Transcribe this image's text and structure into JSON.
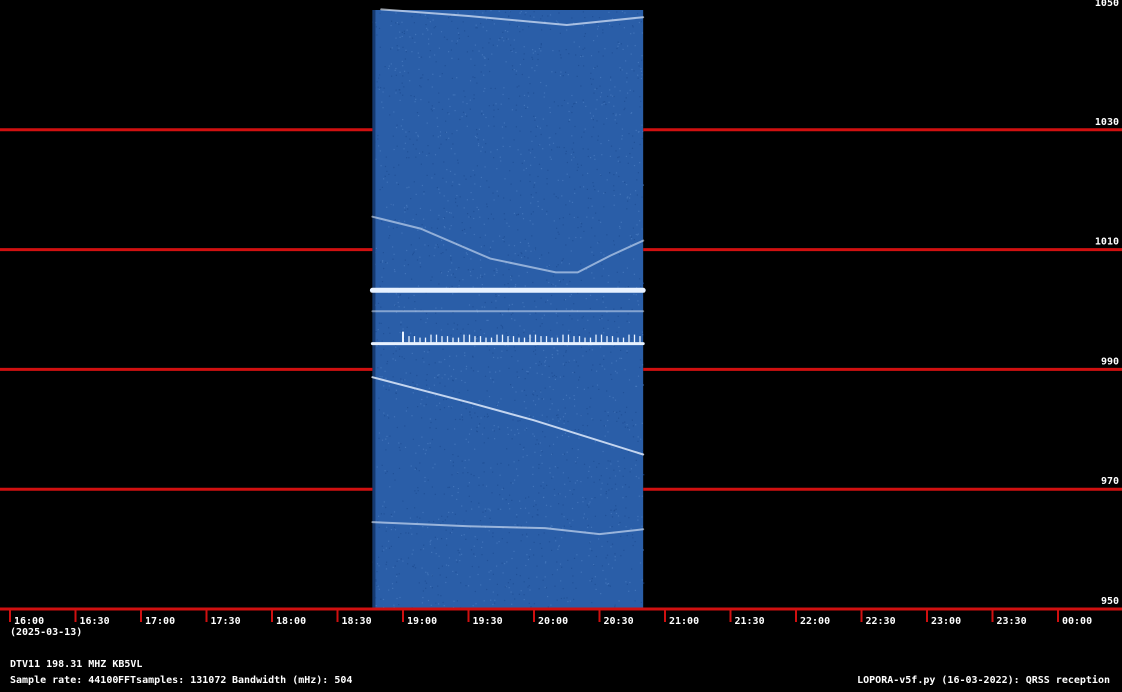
{
  "chart_data": {
    "type": "spectrogram",
    "yaxis": {
      "min": 950,
      "max": 1050,
      "ticks": [
        950,
        970,
        990,
        1010,
        1030,
        1050
      ]
    },
    "xaxis": {
      "ticks": [
        "16:00",
        "16:30",
        "17:00",
        "17:30",
        "18:00",
        "18:30",
        "19:00",
        "19:30",
        "20:00",
        "20:30",
        "21:00",
        "21:30",
        "22:00",
        "22:30",
        "23:00",
        "23:30",
        "00:00"
      ],
      "date_label": "(2025-03-13)"
    },
    "grid": true,
    "data_window": {
      "start": "18:46",
      "end": "20:50"
    },
    "traces": [
      {
        "name": "",
        "points": [
          [
            "18:50",
            1050.1
          ],
          [
            "19:30",
            1049
          ],
          [
            "20:15",
            1047.5
          ],
          [
            "20:50",
            1048.8
          ]
        ],
        "brightness": 0.55
      },
      {
        "name": "",
        "points": [
          [
            "18:46",
            1015.5
          ],
          [
            "19:08",
            1013.5
          ],
          [
            "19:40",
            1008.5
          ],
          [
            "20:10",
            1006.2
          ],
          [
            "20:20",
            1006.2
          ],
          [
            "20:35",
            1009
          ],
          [
            "20:50",
            1011.5
          ]
        ],
        "brightness": 0.4
      },
      {
        "name": "",
        "points": [
          [
            "18:46",
            1003.2
          ],
          [
            "19:30",
            1003.2
          ],
          [
            "20:50",
            1003.2
          ]
        ],
        "brightness": 1.0,
        "thick": true
      },
      {
        "name": "",
        "points": [
          [
            "18:46",
            999.7
          ],
          [
            "20:50",
            999.7
          ]
        ],
        "brightness": 0.3
      },
      {
        "name": "",
        "points": [
          [
            "18:46",
            994.3
          ],
          [
            "19:00",
            994.3
          ],
          [
            "20:50",
            994.3
          ]
        ],
        "brightness": 1.0,
        "spiky": true
      },
      {
        "name": "",
        "points": [
          [
            "18:46",
            988.7
          ],
          [
            "19:30",
            984.5
          ],
          [
            "20:00",
            981.5
          ],
          [
            "20:50",
            975.8
          ]
        ],
        "brightness": 0.75
      },
      {
        "name": "",
        "points": [
          [
            "18:46",
            964.5
          ],
          [
            "19:30",
            963.8
          ],
          [
            "20:05",
            963.5
          ],
          [
            "20:30",
            962.5
          ],
          [
            "20:50",
            963.3
          ]
        ],
        "brightness": 0.45
      }
    ]
  },
  "footer": {
    "station": "DTV11 198.31 MHZ KB5VL",
    "sample_rate": "Sample rate: 44100",
    "fft_samples": "FFTsamples: 131072",
    "bandwidth": "Bandwidth (mHz): 504",
    "software": "LOPORA-v5f.py (16-03-2022): QRSS reception"
  },
  "colors": {
    "background": "#000000",
    "grid": "#d01010",
    "waterfall": "#2a5ea8",
    "trace": "#e8f2ff"
  }
}
